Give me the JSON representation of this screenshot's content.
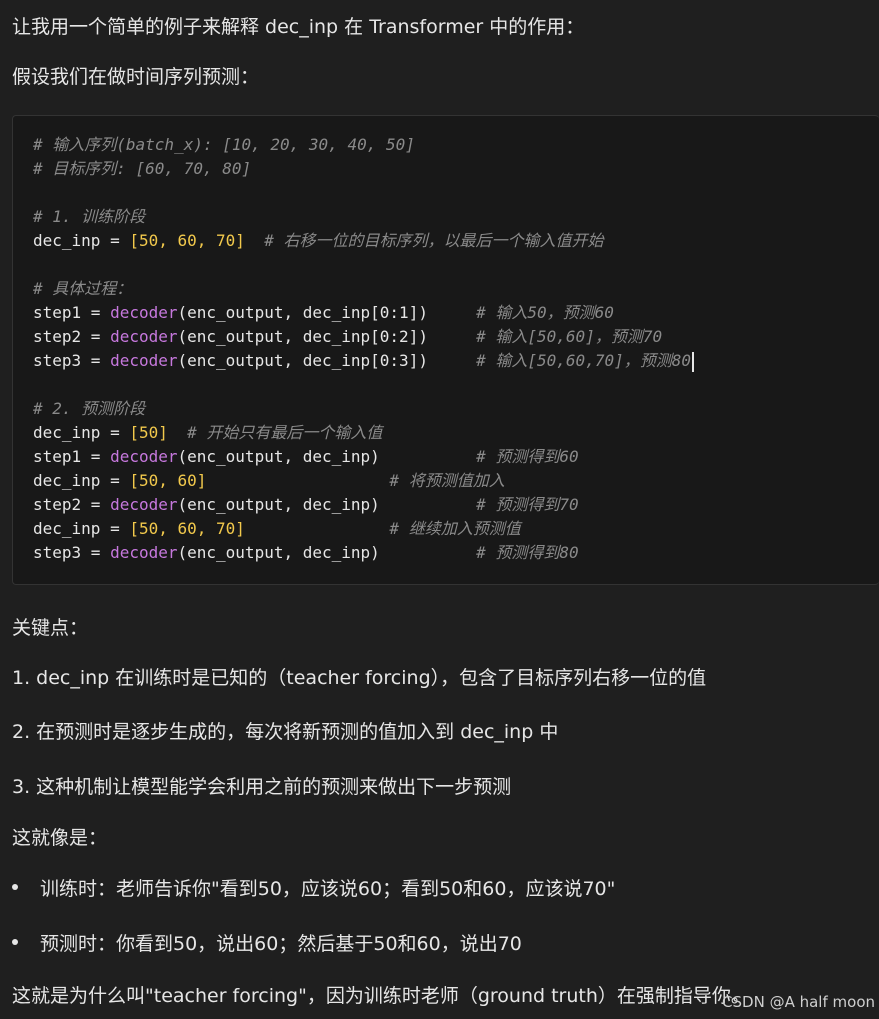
{
  "intro": "让我用一个简单的例子来解释 dec_inp 在 Transformer 中的作用：",
  "assumption": "假设我们在做时间序列预测：",
  "code": {
    "l1": "# 输入序列(batch_x): [10, 20, 30, 40, 50]",
    "l2": "# 目标序列: [60, 70, 80]",
    "l3": "# 1. 训练阶段",
    "l4_a": "dec_inp = ",
    "l4_b": "[50, 60, 70]",
    "l4_c": "# 右移一位的目标序列，以最后一个输入值开始",
    "l5": "# 具体过程：",
    "s1_pre": "step1 = ",
    "fn": "decoder",
    "s1_args": "(enc_output, dec_inp[0:1])",
    "s1_c": "# 输入50，预测60",
    "s2_pre": "step2 = ",
    "s2_args": "(enc_output, dec_inp[0:2])",
    "s2_c": "# 输入[50,60]，预测70",
    "s3_pre": "step3 = ",
    "s3_args": "(enc_output, dec_inp[0:3])",
    "s3_c": "# 输入[50,60,70]，预测80",
    "l6": "# 2. 预测阶段",
    "p1_a": "dec_inp = ",
    "p1_b": "[50]",
    "p1_c": "# 开始只有最后一个输入值",
    "p2_pre": "step1 = ",
    "p2_args": "(enc_output, dec_inp)",
    "p2_c": "# 预测得到60",
    "p3_a": "dec_inp = ",
    "p3_b": "[50, 60]",
    "p3_c": "# 将预测值加入",
    "p4_pre": "step2 = ",
    "p4_args": "(enc_output, dec_inp)",
    "p4_c": "# 预测得到70",
    "p5_a": "dec_inp = ",
    "p5_b": "[50, 60, 70]",
    "p5_c": "# 继续加入预测值",
    "p6_pre": "step3 = ",
    "p6_args": "(enc_output, dec_inp)",
    "p6_c": "# 预测得到80"
  },
  "key_points_title": "关键点：",
  "point1": "1. dec_inp 在训练时是已知的（teacher forcing），包含了目标序列右移一位的值",
  "point2": "2. 在预测时是逐步生成的，每次将新预测的值加入到 dec_inp 中",
  "point3": "3. 这种机制让模型能学会利用之前的预测来做出下一步预测",
  "analogy_title": "这就像是：",
  "bullet1": "训练时：老师告诉你\"看到50，应该说60；看到50和60，应该说70\"",
  "bullet2": "预测时：你看到50，说出60；然后基于50和60，说出70",
  "conclusion": "这就是为什么叫\"teacher forcing\"，因为训练时老师（ground truth）在强制指导你。",
  "watermark": "CSDN @A half moon"
}
